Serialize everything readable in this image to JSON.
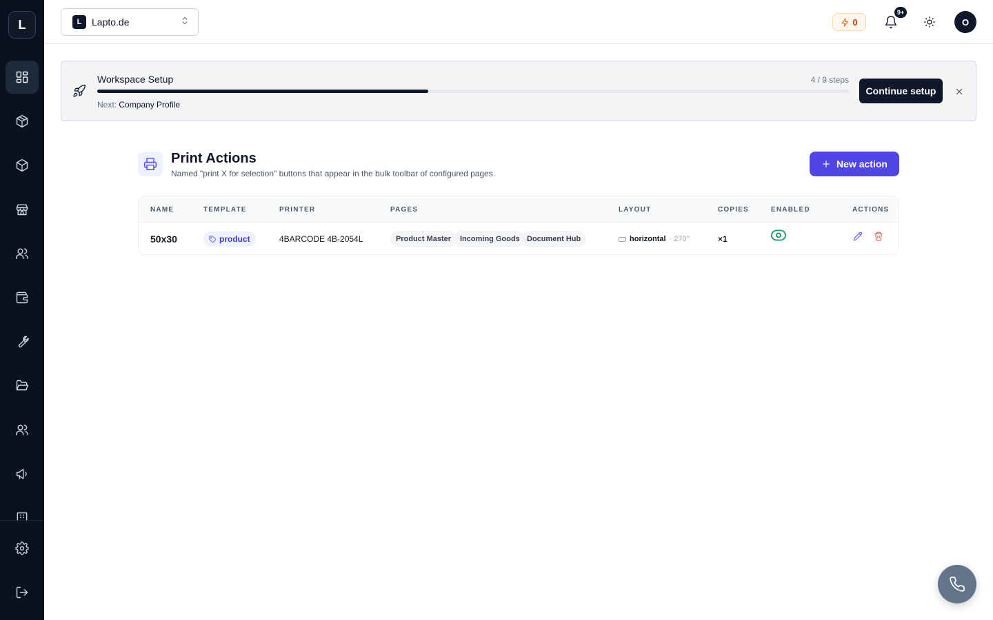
{
  "sidebar": {
    "logo_letter": "L",
    "items": [
      {
        "icon": "dashboard-icon",
        "active": true
      },
      {
        "icon": "box-icon",
        "active": false
      },
      {
        "icon": "package-icon",
        "active": false
      },
      {
        "icon": "store-icon",
        "active": false
      },
      {
        "icon": "users-icon",
        "active": false
      },
      {
        "icon": "wallet-icon",
        "active": false
      },
      {
        "icon": "wrench-icon",
        "active": false
      },
      {
        "icon": "folder-icon",
        "active": false
      },
      {
        "icon": "team-icon",
        "active": false
      },
      {
        "icon": "megaphone-icon",
        "active": false
      }
    ],
    "bottom_items": [
      {
        "icon": "settings-icon"
      },
      {
        "icon": "logout-icon"
      }
    ]
  },
  "topbar": {
    "workspace_badge": "L",
    "workspace_name": "Lapto.de",
    "credits": "0",
    "notifications_badge": "9+",
    "avatar_letter": "O"
  },
  "setup": {
    "title": "Workspace Setup",
    "steps_text": "4 / 9 steps",
    "progress": 0.44,
    "next_label": "Next:",
    "next_value": "Company Profile",
    "button": "Continue setup"
  },
  "page": {
    "title": "Print Actions",
    "subtitle": "Named \"print X for selection\" buttons that appear in the bulk toolbar of configured pages.",
    "new_button": "New action"
  },
  "table": {
    "headers": [
      "NAME",
      "TEMPLATE",
      "PRINTER",
      "PAGES",
      "LAYOUT",
      "COPIES",
      "ENABLED",
      "ACTIONS"
    ],
    "rows": [
      {
        "name": "50x30",
        "template": "product",
        "printer": "4BARCODE 4B-2054L",
        "pages": [
          "Product Master",
          "Incoming Goods",
          "Document Hub"
        ],
        "layout": "horizontal",
        "angle": "· 270°",
        "copies": "×1",
        "enabled": true
      }
    ]
  },
  "colors": {
    "accent": "#4f46e5",
    "sidebar_bg": "#0b1120",
    "enabled_green": "#059669",
    "delete_red": "#ef4444"
  }
}
